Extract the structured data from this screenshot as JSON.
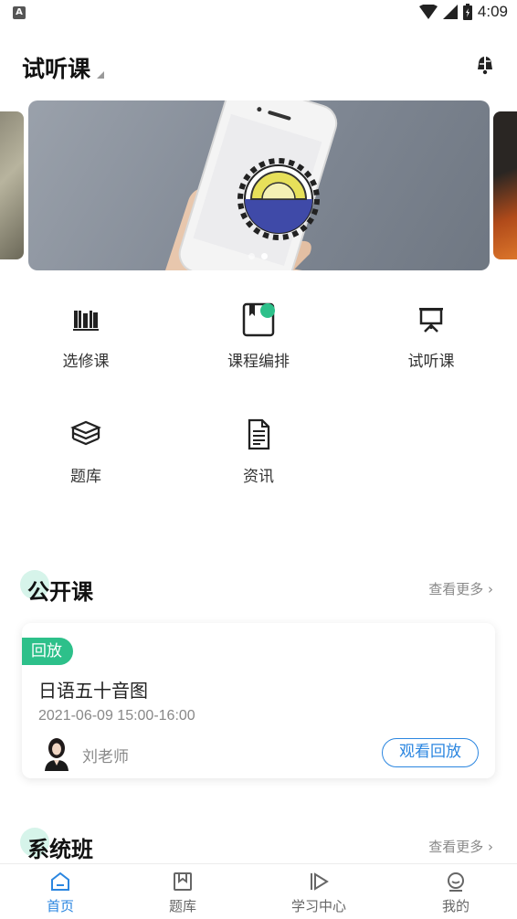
{
  "status_bar": {
    "left_badge": "A",
    "time": "4:09"
  },
  "header": {
    "title": "试听课"
  },
  "entries": [
    {
      "label": "选修课",
      "icon": "books-icon"
    },
    {
      "label": "课程编排",
      "icon": "bookmark-book-icon"
    },
    {
      "label": "试听课",
      "icon": "presentation-board-icon"
    },
    {
      "label": "题库",
      "icon": "stacked-books-icon"
    },
    {
      "label": "资讯",
      "icon": "document-icon"
    }
  ],
  "open_class": {
    "title": "公开课",
    "more": "查看更多",
    "card": {
      "badge": "回放",
      "course_title": "日语五十音图",
      "time": "2021-06-09   15:00-16:00",
      "teacher": "刘老师",
      "button": "观看回放"
    }
  },
  "system_class": {
    "title": "系统班",
    "more": "查看更多"
  },
  "bottom_nav": [
    {
      "label": "首页",
      "icon": "home-icon",
      "active": true
    },
    {
      "label": "题库",
      "icon": "question-bank-icon",
      "active": false
    },
    {
      "label": "学习中心",
      "icon": "play-icon",
      "active": false
    },
    {
      "label": "我的",
      "icon": "profile-icon",
      "active": false
    }
  ],
  "colors": {
    "accent": "#2b86e0",
    "badge": "#2dc08a",
    "blob": "#d6f4ea"
  }
}
